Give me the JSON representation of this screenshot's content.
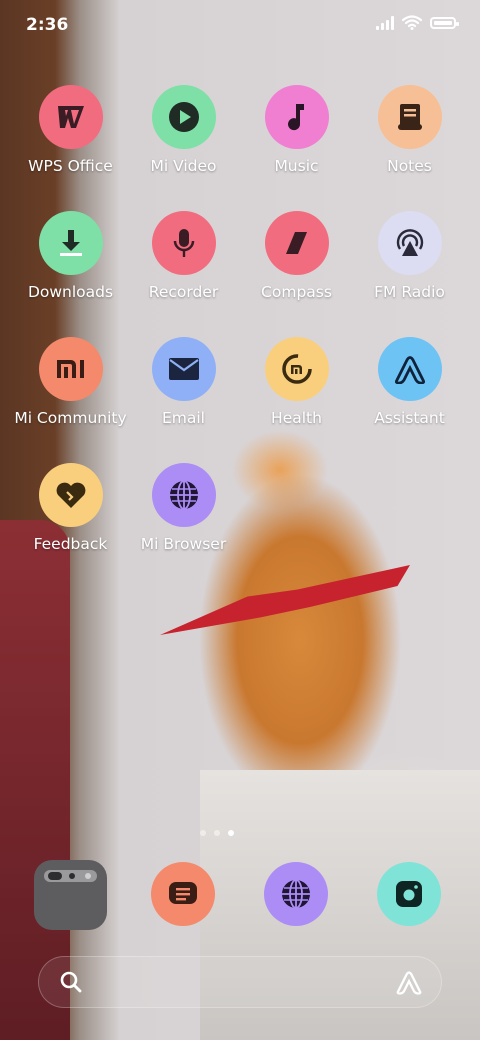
{
  "status_bar": {
    "time": "2:36"
  },
  "apps": [
    {
      "label": "WPS Office",
      "icon": "wps-icon",
      "color": "#f26c7f"
    },
    {
      "label": "Mi Video",
      "icon": "play-icon",
      "color": "#7ee0a6"
    },
    {
      "label": "Music",
      "icon": "music-note-icon",
      "color": "#f07fd2"
    },
    {
      "label": "Notes",
      "icon": "notes-icon",
      "color": "#f7bf95"
    },
    {
      "label": "Downloads",
      "icon": "download-icon",
      "color": "#7ee0a6"
    },
    {
      "label": "Recorder",
      "icon": "microphone-icon",
      "color": "#f26c7f"
    },
    {
      "label": "Compass",
      "icon": "compass-icon",
      "color": "#f26c7f"
    },
    {
      "label": "FM Radio",
      "icon": "radio-icon",
      "color": "#dcdcf2"
    },
    {
      "label": "Mi Community",
      "icon": "mi-logo-icon",
      "color": "#f48a6b"
    },
    {
      "label": "Email",
      "icon": "envelope-icon",
      "color": "#8fb0f6"
    },
    {
      "label": "Health",
      "icon": "health-ring-icon",
      "color": "#f9cf7e"
    },
    {
      "label": "Assistant",
      "icon": "assistant-icon",
      "color": "#6ec3f5"
    },
    {
      "label": "Feedback",
      "icon": "heart-icon",
      "color": "#f9cf7e"
    },
    {
      "label": "Mi Browser",
      "icon": "globe-icon",
      "color": "#ac8df5"
    }
  ],
  "page_indicator": {
    "count": 3,
    "active": 2
  },
  "dock": [
    {
      "name": "folder",
      "icon": "folder-icon",
      "color": "#5d5d5f"
    },
    {
      "name": "messaging",
      "icon": "message-icon",
      "color": "#f48a6b"
    },
    {
      "name": "browser",
      "icon": "globe-icon",
      "color": "#ac8df5"
    },
    {
      "name": "camera",
      "icon": "camera-icon",
      "color": "#7fe3d8"
    }
  ],
  "search": {
    "left_icon": "search-icon",
    "right_icon": "assistant-icon"
  }
}
